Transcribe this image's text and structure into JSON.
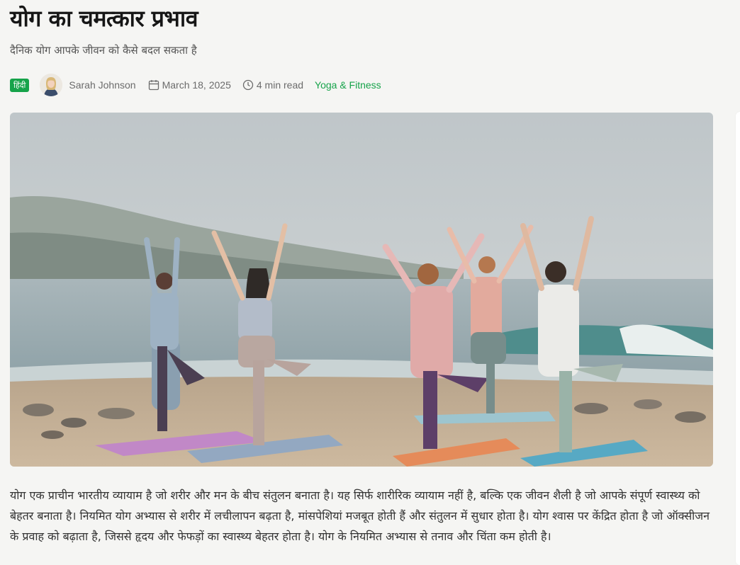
{
  "article": {
    "title": "योग का चमत्कार प्रभाव",
    "subtitle": "दैनिक योग आपके जीवन को कैसे बदल सकता है",
    "meta": {
      "language_badge": "हिंदी",
      "author": "Sarah Johnson",
      "date": "March 18, 2025",
      "read_time": "4 min read",
      "category": "Yoga & Fitness"
    },
    "body": "योग एक प्राचीन भारतीय व्यायाम है जो शरीर और मन के बीच संतुलन बनाता है। यह सिर्फ शारीरिक व्यायाम नहीं है, बल्कि एक जीवन शैली है जो आपके संपूर्ण स्वास्थ्य को बेहतर बनाता है। नियमित योग अभ्यास से शरीर में लचीलापन बढ़ता है, मांसपेशियां मजबूत होती हैं और संतुलन में सुधार होता है। योग श्वास पर केंद्रित होता है जो ऑक्सीजन के प्रवाह को बढ़ाता है, जिससे हृदय और फेफड़ों का स्वास्थ्य बेहतर होता है। योग के नियमित अभ्यास से तनाव और चिंता कम होती है।"
  },
  "icons": {
    "calendar": "calendar-icon",
    "clock": "clock-icon"
  },
  "colors": {
    "accent": "#16a34a",
    "background": "#f5f5f3"
  }
}
